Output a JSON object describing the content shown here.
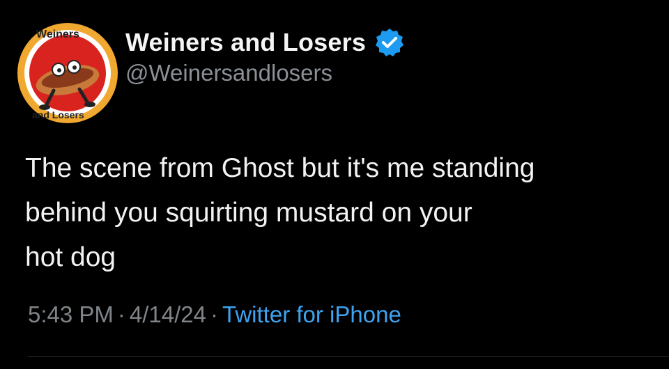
{
  "account": {
    "display_name": "Weiners and Losers",
    "handle": "@Weinersandlosers",
    "verified": true,
    "avatar_icon": "weiners-and-losers-logo",
    "avatar_text_top": "Weiners",
    "avatar_text_bottom": "and Losers"
  },
  "tweet": {
    "lines": [
      "The scene from Ghost but it's me standing",
      "behind you squirting mustard on your",
      "hot dog"
    ]
  },
  "meta": {
    "time": "5:43 PM",
    "separator": "·",
    "date": "4/14/24",
    "source": "Twitter for iPhone"
  },
  "colors": {
    "background": "#000000",
    "text": "#e7e9ea",
    "muted": "#808589",
    "link": "#3ea3f0",
    "verified": "#1d9bf0"
  }
}
